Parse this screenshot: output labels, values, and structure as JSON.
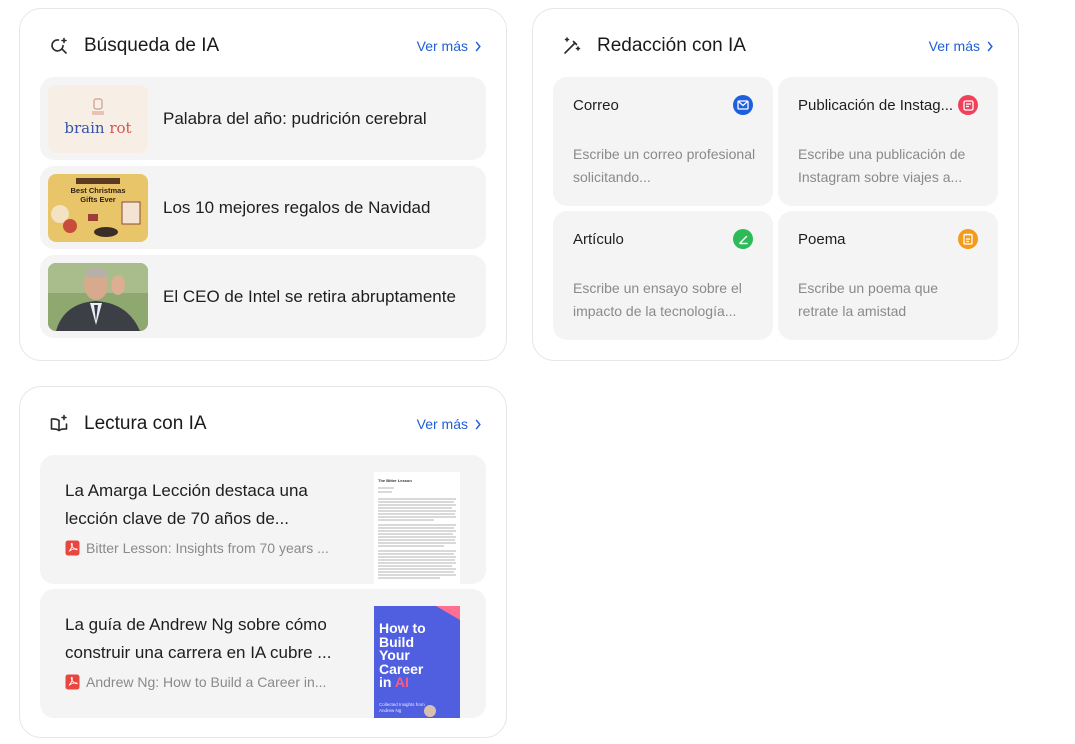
{
  "search": {
    "title": "Búsqueda de IA",
    "more": "Ver más",
    "items": [
      {
        "text": "Palabra del año: pudrición cerebral",
        "thumb_word_1": "brain",
        "thumb_word_2": "rot"
      },
      {
        "text": "Los 10 mejores regalos de Navidad",
        "thumb_line_1": "Best Christmas",
        "thumb_line_2": "Gifts Ever"
      },
      {
        "text": "El CEO de Intel se retira abruptamente"
      }
    ]
  },
  "writing": {
    "title": "Redacción con IA",
    "more": "Ver más",
    "tiles": [
      {
        "title": "Correo",
        "desc": "Escribe un correo profesional solicitando...",
        "icon": "mail-icon",
        "color": "#1e5fe0"
      },
      {
        "title": "Publicación de Instag...",
        "desc": "Escribe una publicación de Instagram sobre viajes a...",
        "icon": "image-post-icon",
        "color": "#f0405a"
      },
      {
        "title": "Artículo",
        "desc": "Escribe un ensayo sobre el impacto de la tecnología...",
        "icon": "pencil-icon",
        "color": "#2dbb59"
      },
      {
        "title": "Poema",
        "desc": "Escribe un poema que retrate la amistad",
        "icon": "note-icon",
        "color": "#f59b1c"
      }
    ]
  },
  "reading": {
    "title": "Lectura con IA",
    "more": "Ver más",
    "items": [
      {
        "title": "La Amarga Lección destaca una lección clave de 70 años de...",
        "source": "Bitter Lesson: Insights from 70 years ...",
        "doc_title": "The Bitter Lesson"
      },
      {
        "title": "La guía de Andrew Ng sobre cómo construir una carrera en IA cubre ...",
        "source": "Andrew Ng: How to Build a Career in...",
        "cover_text_1": "How to",
        "cover_text_2": "Build",
        "cover_text_3": "Your",
        "cover_text_4": "Career",
        "cover_text_5": "in",
        "cover_text_6": "AI",
        "cover_sub": "Collected Insights from Andrew Ng"
      }
    ]
  },
  "colors": {
    "accent": "#1f5fd6",
    "tile_bg": "#f4f4f5",
    "muted": "#8a8a8a"
  }
}
